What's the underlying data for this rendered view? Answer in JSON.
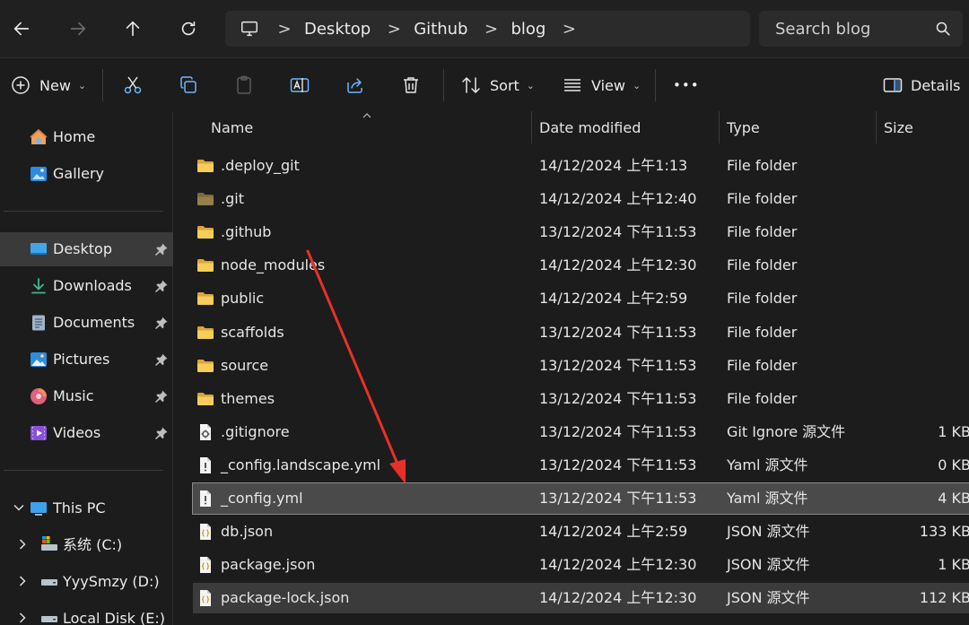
{
  "address_bar": {
    "crumbs": [
      "Desktop",
      "Github",
      "blog"
    ],
    "separator": ">"
  },
  "search": {
    "placeholder": "Search blog"
  },
  "command_bar": {
    "new_label": "New",
    "sort_label": "Sort",
    "view_label": "View",
    "more_label": "•••",
    "details_label": "Details"
  },
  "sidebar": {
    "quick": [
      {
        "label": "Home",
        "icon": "home-icon"
      },
      {
        "label": "Gallery",
        "icon": "gallery-icon"
      }
    ],
    "pinned": [
      {
        "label": "Desktop",
        "icon": "desktop-icon"
      },
      {
        "label": "Downloads",
        "icon": "downloads-icon"
      },
      {
        "label": "Documents",
        "icon": "documents-icon"
      },
      {
        "label": "Pictures",
        "icon": "pictures-icon"
      },
      {
        "label": "Music",
        "icon": "music-icon"
      },
      {
        "label": "Videos",
        "icon": "videos-icon"
      }
    ],
    "devices": [
      {
        "label": "This PC",
        "icon": "pc-icon"
      },
      {
        "label": "系统 (C:)",
        "icon": "drive-icon"
      },
      {
        "label": "YyySmzy (D:)",
        "icon": "drive-icon"
      },
      {
        "label": "Local Disk (E:)",
        "icon": "drive-icon"
      }
    ]
  },
  "columns": {
    "name": "Name",
    "date": "Date modified",
    "type": "Type",
    "size": "Size"
  },
  "files": [
    {
      "name": ".deploy_git",
      "date": "14/12/2024 上午1:13",
      "type": "File folder",
      "size": "",
      "kind": "folder"
    },
    {
      "name": ".git",
      "date": "14/12/2024 上午12:40",
      "type": "File folder",
      "size": "",
      "kind": "folder-dim"
    },
    {
      "name": ".github",
      "date": "13/12/2024 下午11:53",
      "type": "File folder",
      "size": "",
      "kind": "folder"
    },
    {
      "name": "node_modules",
      "date": "14/12/2024 上午12:30",
      "type": "File folder",
      "size": "",
      "kind": "folder"
    },
    {
      "name": "public",
      "date": "14/12/2024 上午2:59",
      "type": "File folder",
      "size": "",
      "kind": "folder"
    },
    {
      "name": "scaffolds",
      "date": "13/12/2024 下午11:53",
      "type": "File folder",
      "size": "",
      "kind": "folder"
    },
    {
      "name": "source",
      "date": "13/12/2024 下午11:53",
      "type": "File folder",
      "size": "",
      "kind": "folder"
    },
    {
      "name": "themes",
      "date": "13/12/2024 下午11:53",
      "type": "File folder",
      "size": "",
      "kind": "folder"
    },
    {
      "name": ".gitignore",
      "date": "13/12/2024 下午11:53",
      "type": "Git Ignore 源文件",
      "size": "1 KB",
      "kind": "gear"
    },
    {
      "name": "_config.landscape.yml",
      "date": "13/12/2024 下午11:53",
      "type": "Yaml 源文件",
      "size": "0 KB",
      "kind": "yaml"
    },
    {
      "name": "_config.yml",
      "date": "13/12/2024 下午11:53",
      "type": "Yaml 源文件",
      "size": "4 KB",
      "kind": "yaml"
    },
    {
      "name": "db.json",
      "date": "14/12/2024 上午2:59",
      "type": "JSON 源文件",
      "size": "133 KB",
      "kind": "json"
    },
    {
      "name": "package.json",
      "date": "14/12/2024 上午12:30",
      "type": "JSON 源文件",
      "size": "1 KB",
      "kind": "json"
    },
    {
      "name": "package-lock.json",
      "date": "14/12/2024 上午12:30",
      "type": "JSON 源文件",
      "size": "112 KB",
      "kind": "json"
    }
  ],
  "colors": {
    "folder": "#f2c94c",
    "accent_arrow": "#e8302a",
    "selected_row": "#4a4a4a"
  }
}
